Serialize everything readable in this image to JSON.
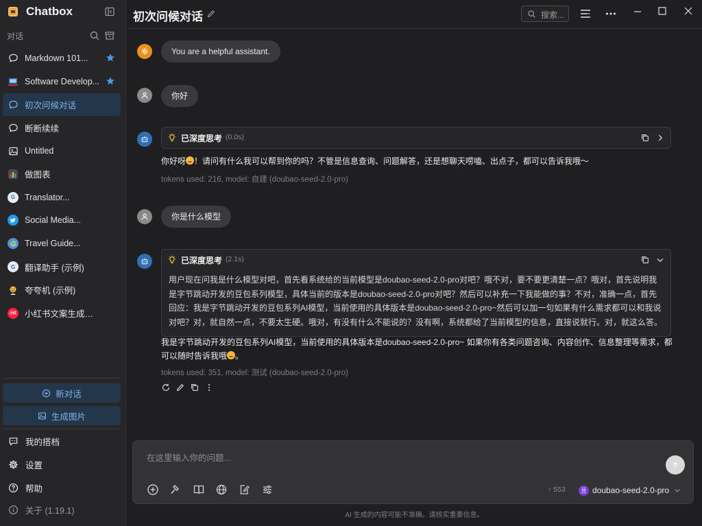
{
  "app": {
    "name": "Chatbox"
  },
  "sidebar": {
    "section_label": "对话",
    "conversations": [
      {
        "label": "Markdown 101...",
        "icon": "chat-bubble-icon",
        "starred": true,
        "active": false
      },
      {
        "label": "Software Develop...",
        "icon": "developer-avatar-icon",
        "starred": true,
        "active": false
      },
      {
        "label": "初次问候对话",
        "icon": "chat-bubble-icon",
        "starred": false,
        "active": true
      },
      {
        "label": "断断续续",
        "icon": "chat-bubble-icon",
        "starred": false,
        "active": false
      },
      {
        "label": "Untitled",
        "icon": "image-icon",
        "starred": false,
        "active": false
      },
      {
        "label": "做图表",
        "icon": "chart-avatar-icon",
        "starred": false,
        "active": false
      },
      {
        "label": "Translator...",
        "icon": "translator-avatar-icon",
        "starred": false,
        "active": false
      },
      {
        "label": "Social Media...",
        "icon": "twitter-bird-icon",
        "starred": false,
        "active": false
      },
      {
        "label": "Travel Guide...",
        "icon": "globe-avatar-icon",
        "starred": false,
        "active": false
      },
      {
        "label": "翻译助手 (示例)",
        "icon": "translator-avatar-icon",
        "starred": false,
        "active": false
      },
      {
        "label": "夸夸机 (示例)",
        "icon": "emoji-avatar-icon",
        "starred": false,
        "active": false
      },
      {
        "label": "小红书文案生成器...",
        "icon": "xiaohongshu-avatar-icon",
        "starred": false,
        "active": false
      }
    ],
    "new_chat_label": "新对话",
    "generate_image_label": "生成图片",
    "footer": {
      "my_partner": "我的搭档",
      "settings": "设置",
      "help": "帮助",
      "about": "关于 (1.19.1)"
    }
  },
  "header": {
    "title": "初次问候对话",
    "search_placeholder": "搜索..."
  },
  "messages": {
    "system": "You are a helpful assistant.",
    "user1": "你好",
    "assistant1": {
      "think_title": "已深度思考",
      "think_time": "(0.0s)",
      "text": "你好呀",
      "text_after": "！请问有什么我可以帮到你的吗？不管是信息查询、问题解答，还是想聊天唠嗑、出点子，都可以告诉我哦～",
      "meta": "tokens used: 216, model: 自建 (doubao-seed-2.0-pro)"
    },
    "user2": "你是什么模型",
    "assistant2": {
      "think_title": "已深度思考",
      "think_time": "(2.1s)",
      "think_text": "用户现在问我是什么模型对吧，首先看系统给的当前模型是doubao-seed-2.0-pro对吧？哦不对，要不要更清楚一点？哦对，首先说明我是字节跳动开发的豆包系列模型，具体当前的版本是doubao-seed-2.0-pro对吧？然后可以补充一下我能做的事？不对，准确一点，首先回应：我是字节跳动开发的豆包系列AI模型，当前使用的具体版本是doubao-seed-2.0-pro~然后可以加一句如果有什么需求都可以和我说对吧？对，就自然一点，不要太生硬。哦对，有没有什么不能说的？没有啊，系统都给了当前模型的信息，直接说就行。对，就这么答。",
      "text": "我是字节跳动开发的豆包系列AI模型，当前使用的具体版本是doubao-seed-2.0-pro~ 如果你有各类问题咨询、内容创作、信息整理等需求，都可以随时告诉我哦",
      "text_after": "。",
      "meta": "tokens used: 351, model: 测试 (doubao-seed-2.0-pro)"
    }
  },
  "composer": {
    "placeholder": "在这里输入你的问题...",
    "token_count": "↑ 553",
    "model_name": "doubao-seed-2.0-pro",
    "model_icon_text": "豆"
  },
  "disclaimer": "AI 生成的内容可能不准确。请核实重要信息。",
  "colors": {
    "accent": "#7fb4ea",
    "active_bg": "#24364a",
    "star": "#4a9be8",
    "system_avatar": "#e8911c",
    "assistant_avatar": "#2f6fb3"
  }
}
